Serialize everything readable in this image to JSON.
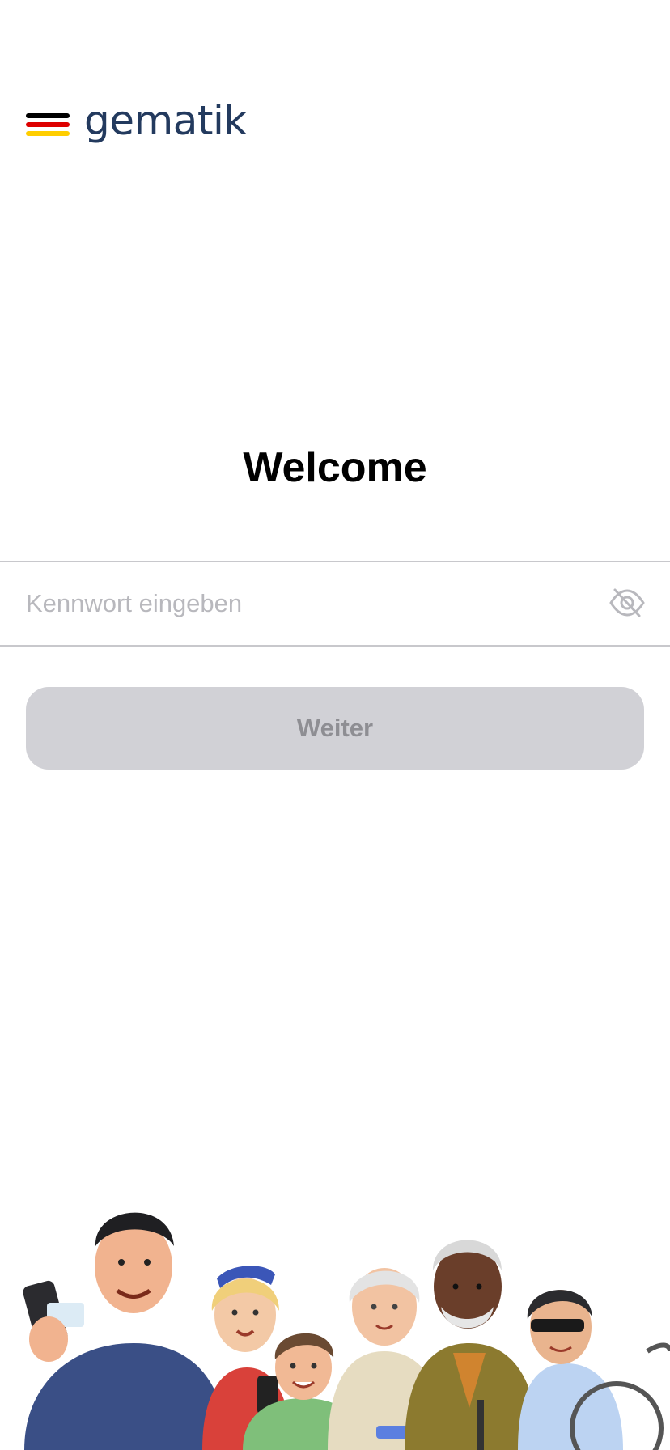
{
  "brand": {
    "name": "gematik",
    "flag_colors": [
      "#000000",
      "#dd0000",
      "#ffce00"
    ],
    "text_color": "#233a5e"
  },
  "title": "Welcome",
  "password": {
    "placeholder": "Kennwort eingeben",
    "value": "",
    "visibility_icon": "eye-slash-icon"
  },
  "continue_button": {
    "label": "Weiter",
    "enabled": false
  },
  "illustration": {
    "description_icon": "people-group-illustration"
  }
}
